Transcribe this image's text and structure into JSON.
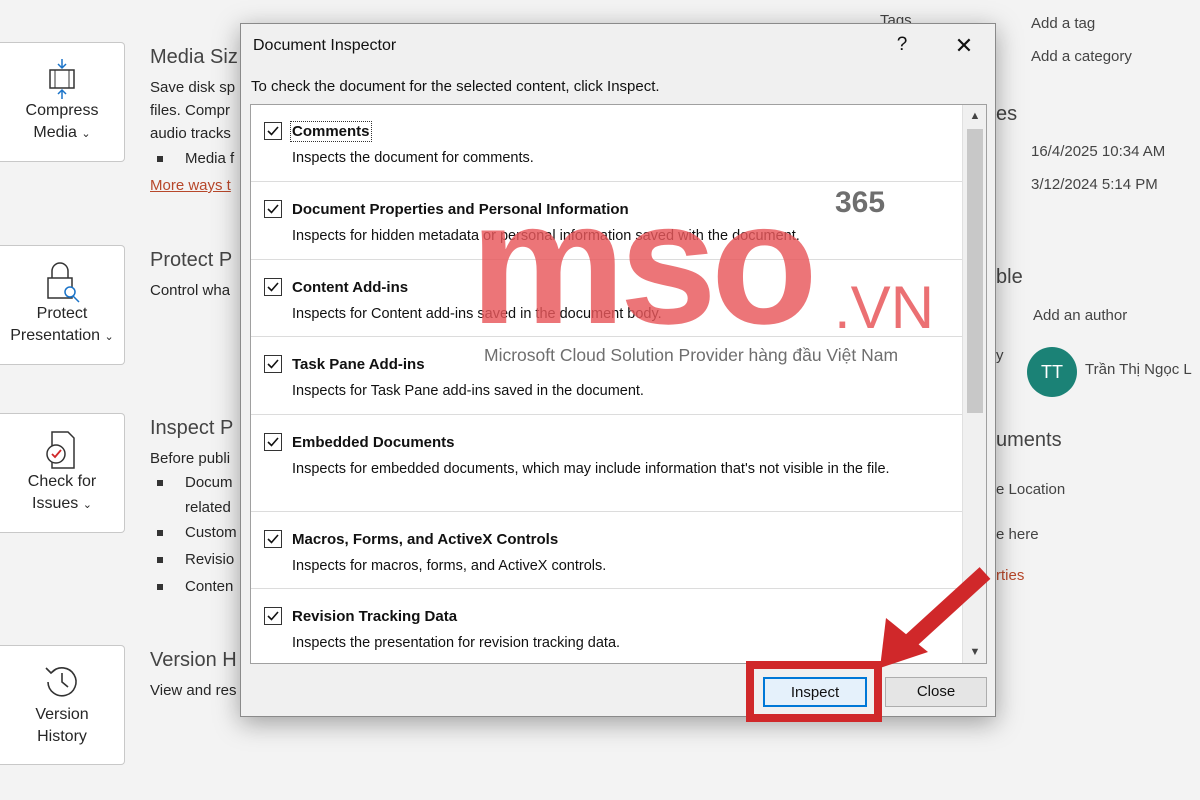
{
  "backstage": {
    "tiles": [
      {
        "line1": "Compress",
        "line2": "Media",
        "icon": "compress-media-icon"
      },
      {
        "line1": "Protect",
        "line2": "Presentation",
        "icon": "lock-key-icon"
      },
      {
        "line1": "Check for",
        "line2": "Issues",
        "icon": "check-document-icon"
      },
      {
        "line1": "Version",
        "line2": "History",
        "icon": "history-clock-icon"
      }
    ],
    "chevron": "⌄",
    "media": {
      "title": "Media Siz",
      "text1": "Save disk sp",
      "text2": "files. Compr",
      "text3": "audio tracks",
      "bullet": "Media f",
      "link": "More ways t"
    },
    "protect": {
      "title": "Protect P",
      "text": "Control wha"
    },
    "inspect": {
      "title": "Inspect P",
      "text": "Before publi",
      "b1": "Docum",
      "b1b": "related",
      "b2": "Custom",
      "b3": "Revisio",
      "b4": "Conten"
    },
    "version": {
      "title": "Version H",
      "text": "View and res"
    }
  },
  "properties": {
    "tags_label": "Tags",
    "add_tag": "Add a tag",
    "add_category": "Add a category",
    "dates_label": "es",
    "date1": "16/4/2025 10:34 AM",
    "date2": "3/12/2024 5:14 PM",
    "people_label": "ble",
    "add_author": "Add an author",
    "by_label": "y",
    "avatar_initials": "TT",
    "author_name": "Trần Thị Ngọc L",
    "related_docs": "uments",
    "file_location": "e Location",
    "here": "e here",
    "properties_link": "rties"
  },
  "dialog": {
    "title": "Document Inspector",
    "help": "?",
    "close": "✕",
    "instruction": "To check the document for the selected content, click Inspect.",
    "items": [
      {
        "title": "Comments",
        "desc": "Inspects the document for comments.",
        "checked": true
      },
      {
        "title": "Document Properties and Personal Information",
        "desc": "Inspects for hidden metadata or personal information saved with the document.",
        "checked": true
      },
      {
        "title": "Content Add-ins",
        "desc": "Inspects for Content add-ins saved in the document body.",
        "checked": true
      },
      {
        "title": "Task Pane Add-ins",
        "desc": "Inspects for Task Pane add-ins saved in the document.",
        "checked": true
      },
      {
        "title": "Embedded Documents",
        "desc": "Inspects for embedded documents, which may include information that's not visible in the file.",
        "checked": true
      },
      {
        "title": "Macros, Forms, and ActiveX Controls",
        "desc": "Inspects for macros, forms, and ActiveX controls.",
        "checked": true
      },
      {
        "title": "Revision Tracking Data",
        "desc": "Inspects the presentation for revision tracking data.",
        "checked": true
      }
    ],
    "inspect_button": "Inspect",
    "close_button": "Close"
  },
  "watermark": {
    "brand": "mso",
    "suffix": ".VN",
    "badge": "365",
    "tagline": "Microsoft Cloud Solution Provider hàng đầu Việt Nam"
  },
  "colors": {
    "accent": "#0078d7",
    "annotation": "#d0282a",
    "watermark": "#e8575a",
    "link": "#b7472a",
    "avatar": "#1b8276"
  }
}
